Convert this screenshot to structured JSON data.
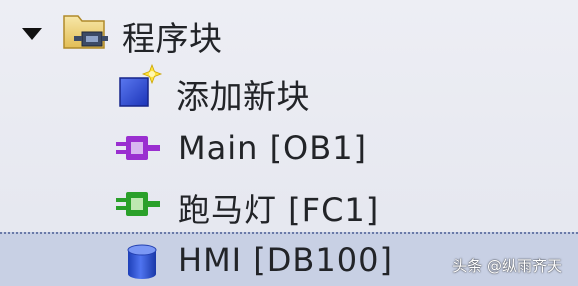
{
  "tree": {
    "root": {
      "label": "程序块",
      "expanded": true,
      "icon": "folder-block-icon"
    },
    "items": [
      {
        "label": "添加新块",
        "icon": "add-new-block-icon",
        "color": "#2a4ad8"
      },
      {
        "label": "Main [OB1]",
        "icon": "organization-block-icon",
        "color": "#9a2fd0"
      },
      {
        "label": "跑马灯 [FC1]",
        "icon": "function-block-icon",
        "color": "#2aa02a"
      },
      {
        "label": "HMI [DB100]",
        "icon": "data-block-icon",
        "color": "#2a55e0",
        "selected": true
      }
    ]
  },
  "watermark": "头条 @纵雨齐天"
}
